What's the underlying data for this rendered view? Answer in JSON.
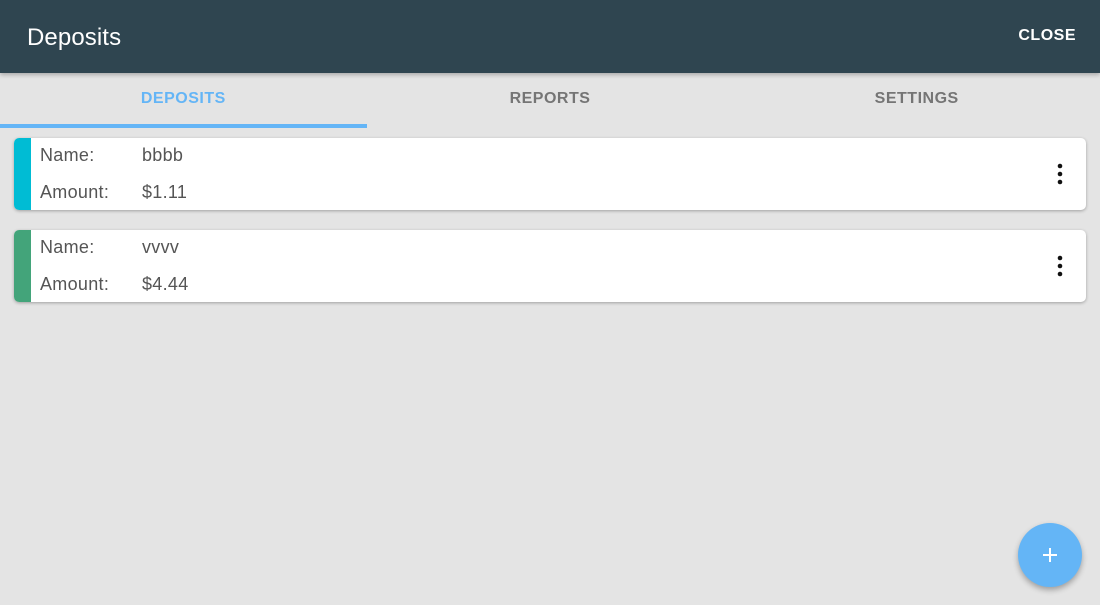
{
  "toolbar": {
    "title": "Deposits",
    "close_label": "CLOSE"
  },
  "tabs": [
    {
      "label": "DEPOSITS",
      "active": true
    },
    {
      "label": "REPORTS",
      "active": false
    },
    {
      "label": "SETTINGS",
      "active": false
    }
  ],
  "deposits": [
    {
      "name_label": "Name:",
      "name": "bbbb",
      "amount_label": "Amount:",
      "amount": "$1.11",
      "color": "#00bcd4",
      "menu_icon": "more-vert-icon"
    },
    {
      "name_label": "Name:",
      "name": "vvvv",
      "amount_label": "Amount:",
      "amount": "$4.44",
      "color": "#43a47a",
      "menu_icon": "more-vert-icon"
    }
  ],
  "fab": {
    "icon": "plus-icon"
  },
  "colors": {
    "toolbar": "#2f4550",
    "accent": "#64b5f6",
    "background": "#e4e4e4",
    "tab_inactive": "#757575"
  }
}
